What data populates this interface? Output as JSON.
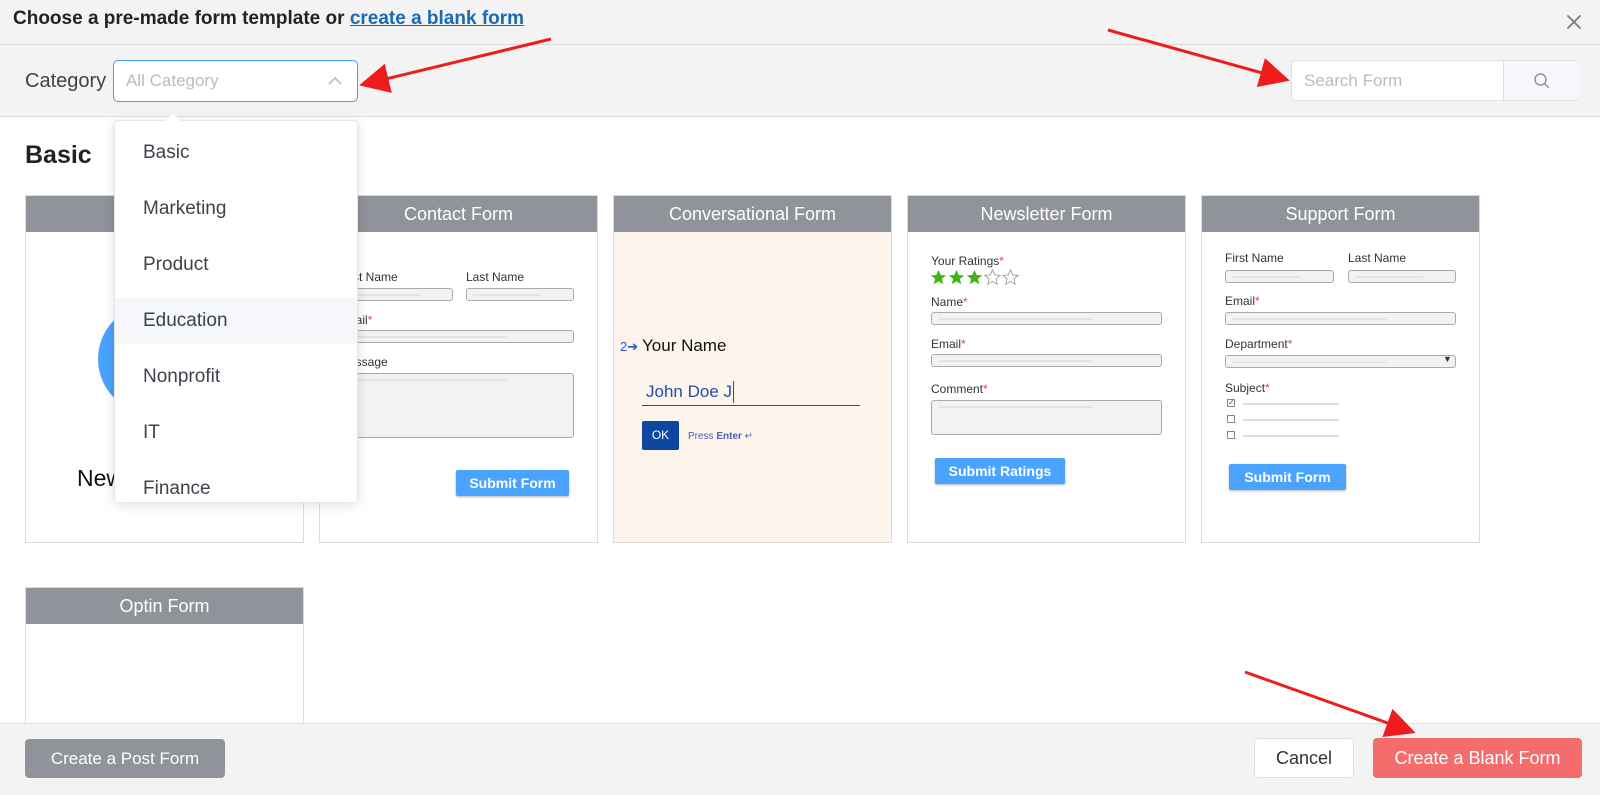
{
  "header": {
    "title_prefix": "Choose a pre-made form template or",
    "title_link": "create a blank form"
  },
  "filter": {
    "category_label": "Category",
    "category_placeholder": "All Category",
    "search_placeholder": "Search Form"
  },
  "dropdown": {
    "items": [
      "Basic",
      "Marketing",
      "Product",
      "Education",
      "Nonprofit",
      "IT",
      "Finance"
    ]
  },
  "section": {
    "title": "Basic"
  },
  "cards": {
    "first_partial_text": "New",
    "contact": {
      "title": "Contact Form",
      "first_name": "rst Name",
      "last_name": "Last Name",
      "email": "nail",
      "message": "essage",
      "submit": "Submit Form"
    },
    "conversational": {
      "title": "Conversational Form",
      "step": "2",
      "question": "Your Name",
      "answer": "John Doe J",
      "ok": "OK",
      "press": "Press",
      "enter": "Enter"
    },
    "newsletter": {
      "title": "Newsletter Form",
      "ratings": "Your Ratings",
      "rating_value": 3,
      "rating_max": 5,
      "name": "Name",
      "email": "Email",
      "comment": "Comment",
      "submit": "Submit Ratings"
    },
    "support": {
      "title": "Support Form",
      "first_name": "First Name",
      "last_name": "Last Name",
      "email": "Email",
      "department": "Department",
      "subject": "Subject",
      "submit": "Submit Form"
    },
    "optin": {
      "title": "Optin Form"
    }
  },
  "footer": {
    "post_form": "Create a Post Form",
    "cancel": "Cancel",
    "blank_form": "Create a Blank Form"
  },
  "colors": {
    "accent": "#409eff",
    "link": "#1a69b4",
    "card_header": "#909399",
    "danger": "#f56c6c",
    "star": "#3fb618"
  },
  "icons": {
    "close": "close-icon",
    "chevron": "chevron-up-icon",
    "search": "search-icon",
    "star": "star-icon"
  }
}
